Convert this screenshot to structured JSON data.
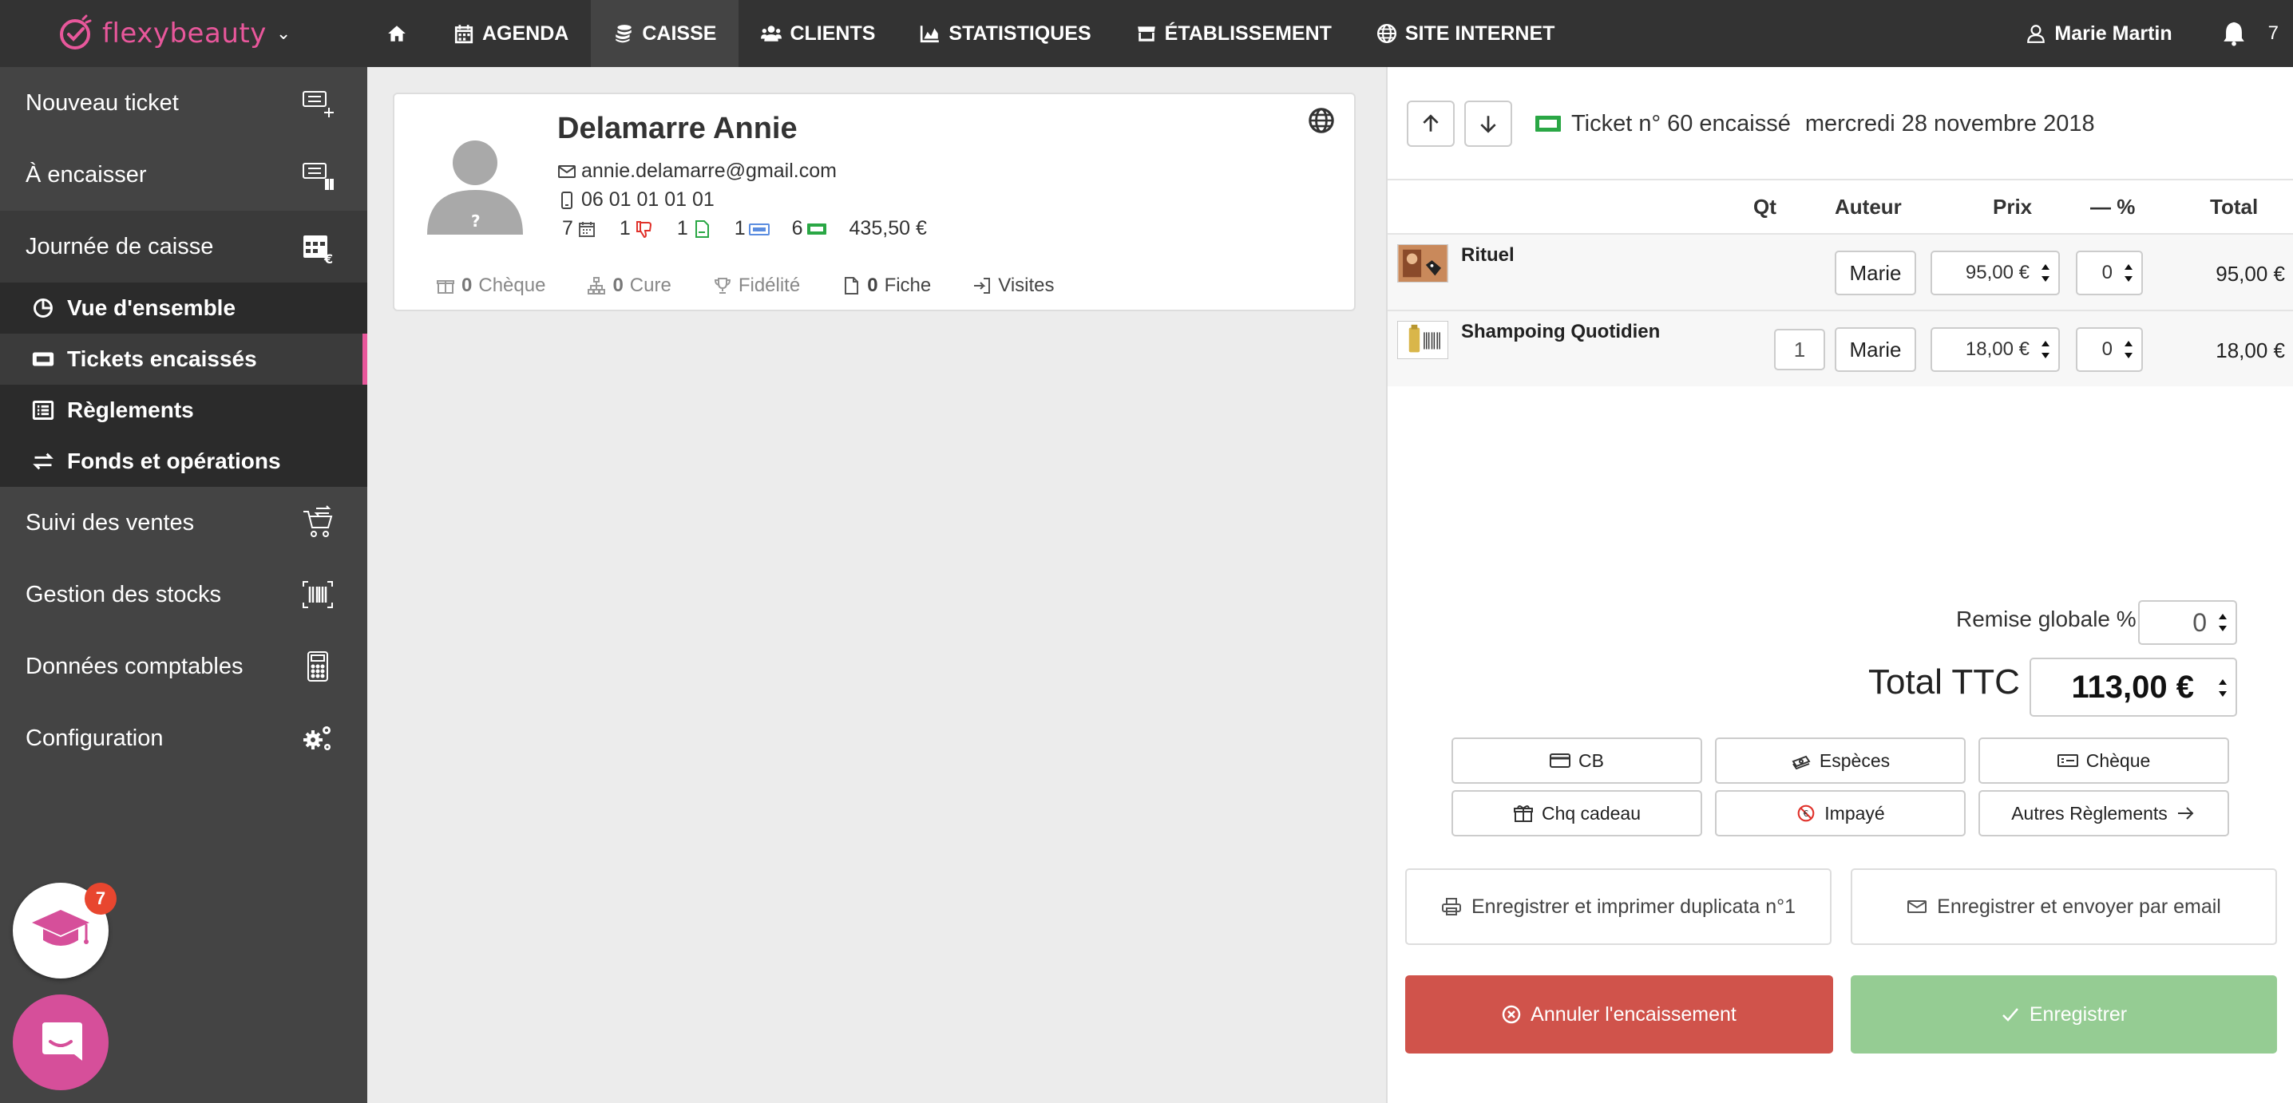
{
  "nav": {
    "brand": "flexybeauty",
    "items": [
      {
        "label": "AGENDA"
      },
      {
        "label": "CAISSE"
      },
      {
        "label": "CLIENTS"
      },
      {
        "label": "STATISTIQUES"
      },
      {
        "label": "ÉTABLISSEMENT"
      },
      {
        "label": "SITE INTERNET"
      }
    ],
    "user": "Marie Martin",
    "notif_count": "7"
  },
  "sidebar": {
    "items": [
      {
        "label": "Nouveau ticket"
      },
      {
        "label": "À encaisser"
      },
      {
        "label": "Journée de caisse"
      },
      {
        "label": "Suivi des ventes"
      },
      {
        "label": "Gestion des stocks"
      },
      {
        "label": "Données comptables"
      },
      {
        "label": "Configuration"
      }
    ],
    "sub_items": [
      {
        "label": "Vue d'ensemble"
      },
      {
        "label": "Tickets encaissés"
      },
      {
        "label": "Règlements"
      },
      {
        "label": "Fonds et opérations"
      }
    ],
    "academy_badge": "7"
  },
  "client": {
    "name": "Delamarre Annie",
    "email": "annie.delamarre@gmail.com",
    "phone": "06 01 01 01 01",
    "stats": {
      "appointments": "7",
      "dislikes": "1",
      "sheets": "1",
      "tickets": "1",
      "paid": "6",
      "amount": "435,50 €"
    },
    "tabs": {
      "cheque_count": "0",
      "cheque_label": "Chèque",
      "cure_count": "0",
      "cure_label": "Cure",
      "fidelite_label": "Fidélité",
      "fiche_count": "0",
      "fiche_label": "Fiche",
      "visites_label": "Visites"
    }
  },
  "ticket": {
    "title": "Ticket n° 60 encaissé",
    "date": "mercredi 28 novembre 2018",
    "columns": {
      "qt": "Qt",
      "auteur": "Auteur",
      "prix": "Prix",
      "remise": "— %",
      "total": "Total"
    },
    "lines": [
      {
        "name": "Rituel",
        "qty": "",
        "author": "Marie",
        "price": "95,00 €",
        "discount": "0",
        "total": "95,00 €"
      },
      {
        "name": "Shampoing Quotidien",
        "qty": "1",
        "author": "Marie",
        "price": "18,00 €",
        "discount": "0",
        "total": "18,00 €"
      }
    ],
    "remise_label": "Remise globale %",
    "remise_value": "0",
    "total_label": "Total TTC",
    "total_value": "113,00 €",
    "payments": {
      "cb": "CB",
      "especes": "Espèces",
      "cheque": "Chèque",
      "chq_cadeau": "Chq cadeau",
      "impaye": "Impayé",
      "autres": "Autres Règlements"
    },
    "actions": {
      "print": "Enregistrer et imprimer duplicata n°1",
      "email": "Enregistrer et envoyer par email",
      "cancel": "Annuler l'encaissement",
      "save": "Enregistrer"
    }
  },
  "colors": {
    "brand": "#e8579b",
    "nav_bg": "#333333",
    "sidebar_bg": "#444444",
    "cancel": "#d0534b",
    "confirm": "#95cc93",
    "ticket_green": "#2aa745"
  }
}
